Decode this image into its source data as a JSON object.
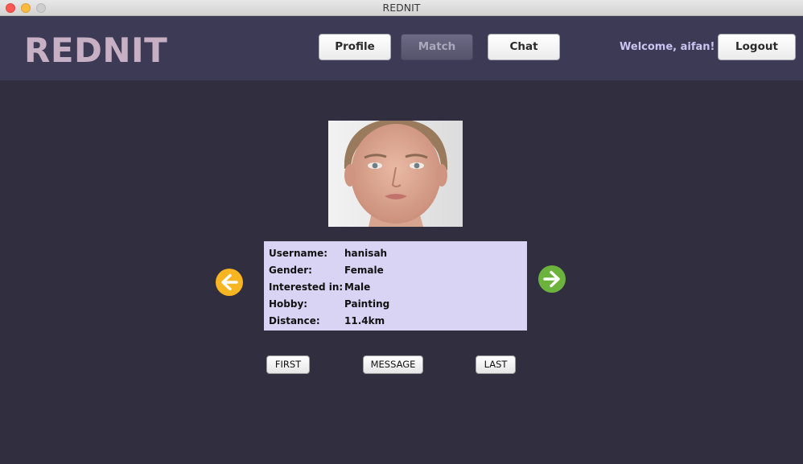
{
  "window": {
    "title": "REDNIT"
  },
  "header": {
    "logo": "REDNIT",
    "nav": [
      {
        "label": "Profile"
      },
      {
        "label": "Match"
      },
      {
        "label": "Chat"
      }
    ],
    "welcome": "Welcome, aifan!",
    "logout_label": "Logout"
  },
  "profile": {
    "photo": "profile-photo",
    "fields": [
      {
        "label": "Username:",
        "value": "hanisah"
      },
      {
        "label": "Gender:",
        "value": "Female"
      },
      {
        "label": "Interested in:",
        "value": "Male"
      },
      {
        "label": "Hobby:",
        "value": "Painting"
      },
      {
        "label": "Distance:",
        "value": "11.4km"
      }
    ]
  },
  "controls": {
    "first_label": "FIRST",
    "message_label": "MESSAGE",
    "last_label": "LAST",
    "prev_icon": "arrow-left-icon",
    "next_icon": "arrow-right-icon"
  },
  "colors": {
    "background": "#312e3f",
    "header": "#3d3a56",
    "logo": "#c7b0c3",
    "panel": "#d9d4f3",
    "prev_arrow": "#f7b521",
    "next_arrow": "#6cb33e"
  }
}
